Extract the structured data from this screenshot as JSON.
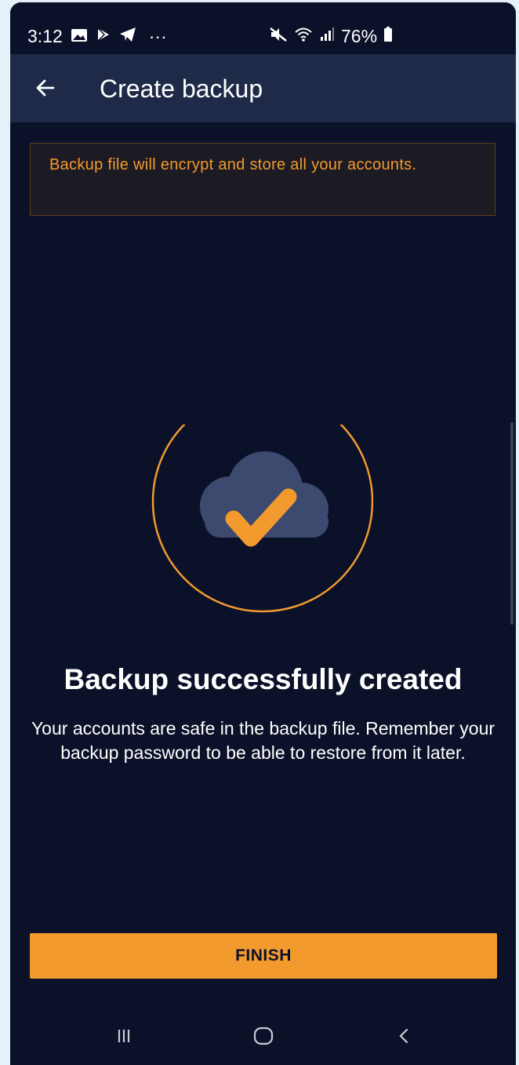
{
  "status_bar": {
    "time": "3:12",
    "left_icons": [
      "gallery-icon",
      "play-store-icon",
      "telegram-icon"
    ],
    "more_indicator": "···",
    "right_icons": [
      "mute-icon",
      "wifi-icon",
      "signal-icon"
    ],
    "battery_percent": "76%"
  },
  "app_bar": {
    "title": "Create backup",
    "back_icon": "arrow-back-icon"
  },
  "banner": {
    "text": "Backup file will encrypt and store all your accounts."
  },
  "illustration": {
    "icon": "cloud-check-icon"
  },
  "success": {
    "title": "Backup successfully created",
    "description": "Your accounts are safe in the backup file. Remember your backup password to be able to restore from it later."
  },
  "finish_button": {
    "label": "FINISH"
  },
  "nav_bar": {
    "items": [
      "recents-icon",
      "home-icon",
      "back-icon"
    ]
  },
  "colors": {
    "background": "#0b1128",
    "app_bar": "#1e2a47",
    "accent": "#f39a2e",
    "cloud": "#3b4a6e"
  }
}
